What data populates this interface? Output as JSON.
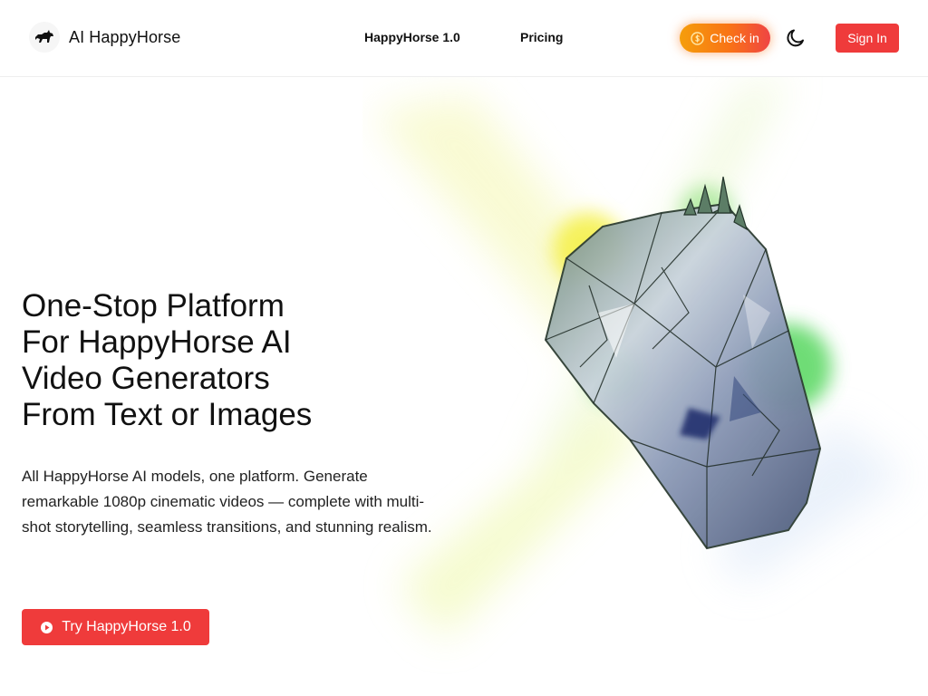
{
  "header": {
    "brand": "AI HappyHorse",
    "nav": [
      {
        "label": "HappyHorse 1.0"
      },
      {
        "label": "Pricing"
      }
    ],
    "checkin_label": "Check in",
    "signin_label": "Sign In"
  },
  "hero": {
    "title_lines": [
      "One-Stop Platform",
      "For HappyHorse AI",
      "Video Generators",
      "From Text or Images"
    ],
    "description": "All HappyHorse AI models, one platform. Generate remarkable 1080p cinematic videos — complete with multi-shot storytelling, seamless transitions, and stunning realism.",
    "cta_label": "Try HappyHorse 1.0"
  },
  "icons": {
    "logo": "horse-icon",
    "checkin": "coin-icon",
    "theme": "moon-icon",
    "cta": "play-icon"
  },
  "colors": {
    "primary": "#ef3b3b",
    "checkin_start": "#f59e0b",
    "checkin_end": "#ef4444"
  }
}
